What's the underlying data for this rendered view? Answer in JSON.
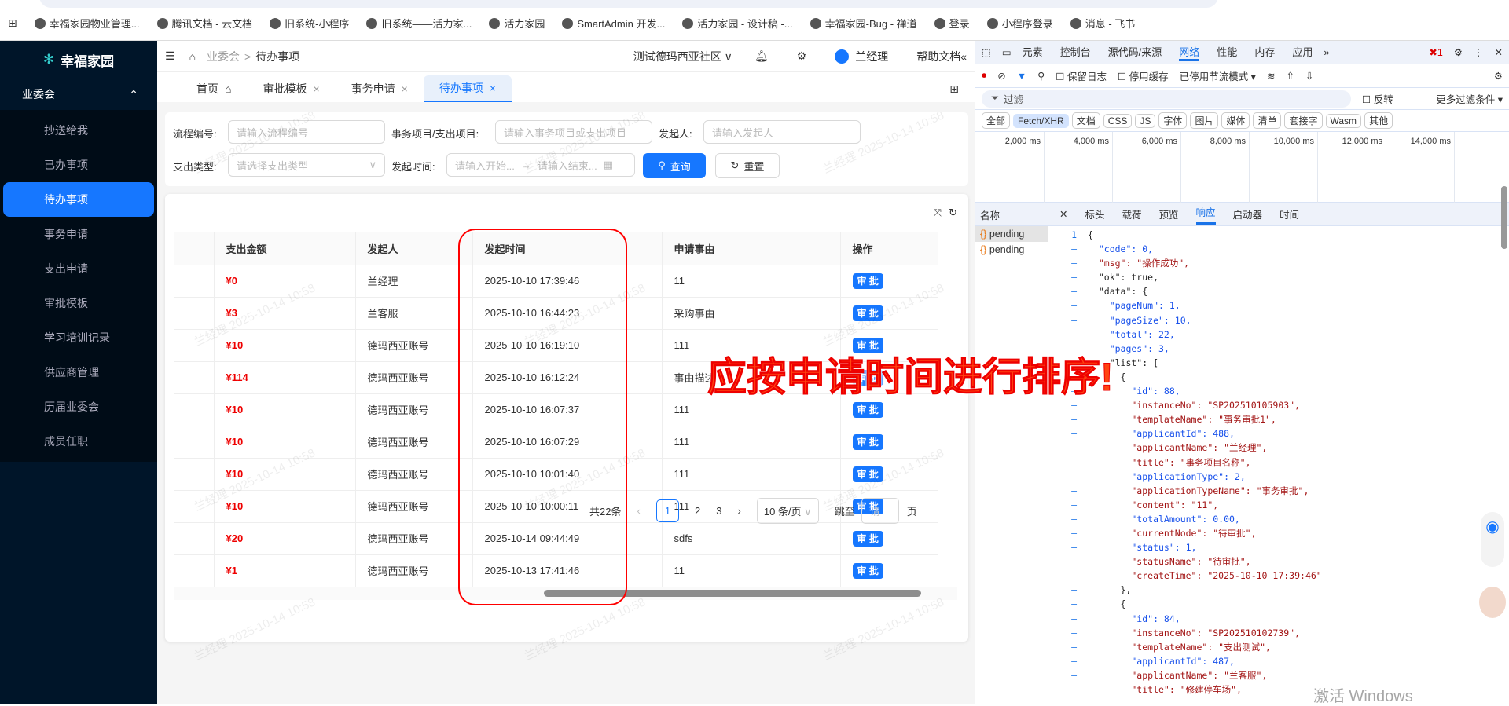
{
  "bookmarks": [
    "幸福家园物业管理...",
    "腾讯文档 - 云文档",
    "旧系统-小程序",
    "旧系统——活力家...",
    "活力家园",
    "SmartAdmin 开发...",
    "活力家园 - 设计稿 -...",
    "幸福家园-Bug - 禅道",
    "登录",
    "小程序登录",
    "消息 - 飞书"
  ],
  "sidebar": {
    "logo": "幸福家园",
    "group": "业委会",
    "items": [
      "抄送给我",
      "已办事项",
      "待办事项",
      "事务申请",
      "支出申请",
      "审批模板",
      "学习培训记录",
      "供应商管理",
      "历届业委会",
      "成员任职"
    ],
    "active": 2
  },
  "header": {
    "breadcrumb": [
      "业委会",
      "待办事项"
    ],
    "community": "测试德玛西亚社区",
    "user": "兰经理",
    "help": "帮助文档"
  },
  "tabs": [
    "首页",
    "审批模板",
    "事务申请",
    "待办事项"
  ],
  "filters": {
    "process_no_label": "流程编号:",
    "process_no_ph": "请输入流程编号",
    "item_label": "事务项目/支出项目:",
    "item_ph": "请输入事务项目或支出项目",
    "applicant_label": "发起人:",
    "applicant_ph": "请输入发起人",
    "type_label": "支出类型:",
    "type_ph": "请选择支出类型",
    "time_label": "发起时间:",
    "start_ph": "请输入开始...",
    "end_ph": "请输入结束...",
    "search": "查询",
    "reset": "重置"
  },
  "table": {
    "headers": [
      "支出金额",
      "发起人",
      "发起时间",
      "申请事由",
      "操作"
    ],
    "rows": [
      [
        "¥0",
        "兰经理",
        "2025-10-10 17:39:46",
        "11",
        "审 批"
      ],
      [
        "¥3",
        "兰客服",
        "2025-10-10 16:44:23",
        "采购事由",
        "审 批"
      ],
      [
        "¥10",
        "德玛西亚账号",
        "2025-10-10 16:19:10",
        "111",
        "审 批"
      ],
      [
        "¥114",
        "德玛西亚账号",
        "2025-10-10 16:12:24",
        "事由描述",
        "审 批"
      ],
      [
        "¥10",
        "德玛西亚账号",
        "2025-10-10 16:07:37",
        "111",
        "审 批"
      ],
      [
        "¥10",
        "德玛西亚账号",
        "2025-10-10 16:07:29",
        "111",
        "审 批"
      ],
      [
        "¥10",
        "德玛西亚账号",
        "2025-10-10 10:01:40",
        "111",
        "审 批"
      ],
      [
        "¥10",
        "德玛西亚账号",
        "2025-10-10 10:00:11",
        "111",
        "审 批"
      ],
      [
        "¥20",
        "德玛西亚账号",
        "2025-10-14 09:44:49",
        "sdfs",
        "审 批"
      ],
      [
        "¥1",
        "德玛西亚账号",
        "2025-10-13 17:41:46",
        "11",
        "审 批"
      ]
    ]
  },
  "pagination": {
    "total": "共22条",
    "pages": [
      "1",
      "2",
      "3"
    ],
    "size": "10 条/页",
    "jump": "跳至",
    "jump_ph": "请",
    "page": "页"
  },
  "watermark": "兰经理 2025-10-14 10:58",
  "annotation": "应按申请时间进行排序!",
  "devtools": {
    "tabs": [
      "元素",
      "控制台",
      "源代码/来源",
      "网络",
      "性能",
      "内存",
      "应用"
    ],
    "errors": "1",
    "preserve_log": "保留日志",
    "disable_cache": "停用缓存",
    "throttle": "已停用节流模式",
    "filter_ph": "过滤",
    "invert": "反转",
    "more_filters": "更多过滤条件",
    "types": [
      "全部",
      "Fetch/XHR",
      "文档",
      "CSS",
      "JS",
      "字体",
      "图片",
      "媒体",
      "清单",
      "套接字",
      "Wasm",
      "其他"
    ],
    "timeline": [
      "2,000 ms",
      "4,000 ms",
      "6,000 ms",
      "8,000 ms",
      "10,000 ms",
      "12,000 ms",
      "14,000 ms"
    ],
    "name_header": "名称",
    "requests": [
      "pending",
      "pending"
    ],
    "detail_tabs": [
      "标头",
      "载荷",
      "预览",
      "响应",
      "启动器",
      "时间"
    ],
    "response_lines": [
      "{",
      "  \"code\": 0,",
      "  \"msg\": \"操作成功\",",
      "  \"ok\": true,",
      "  \"data\": {",
      "    \"pageNum\": 1,",
      "    \"pageSize\": 10,",
      "    \"total\": 22,",
      "    \"pages\": 3,",
      "    \"list\": [",
      "      {",
      "        \"id\": 88,",
      "        \"instanceNo\": \"SP202510105903\",",
      "        \"templateName\": \"事务审批1\",",
      "        \"applicantId\": 488,",
      "        \"applicantName\": \"兰经理\",",
      "        \"title\": \"事务项目名称\",",
      "        \"applicationType\": 2,",
      "        \"applicationTypeName\": \"事务审批\",",
      "        \"content\": \"11\",",
      "        \"totalAmount\": 0.00,",
      "        \"currentNode\": \"待审批\",",
      "        \"status\": 1,",
      "        \"statusName\": \"待审批\",",
      "        \"createTime\": \"2025-10-10 17:39:46\"",
      "      },",
      "      {",
      "        \"id\": 84,",
      "        \"instanceNo\": \"SP202510102739\",",
      "        \"templateName\": \"支出测试\",",
      "        \"applicantId\": 487,",
      "        \"applicantName\": \"兰客服\",",
      "        \"title\": \"修建停车场\","
    ]
  },
  "os_watermark": "激活 Windows"
}
